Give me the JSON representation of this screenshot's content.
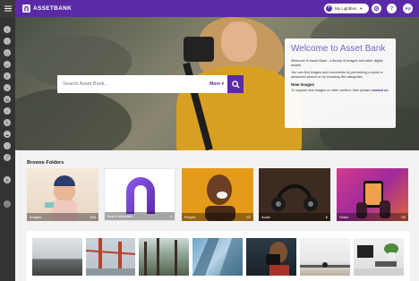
{
  "app": {
    "name": "ASSETBANK"
  },
  "header": {
    "lightbox_label": "My Lightbox",
    "user_initials": "AU"
  },
  "search": {
    "placeholder": "Search Asset Bank...",
    "more_label": "More"
  },
  "welcome": {
    "title": "Welcome to Asset Bank",
    "intro": "Welcome to Asset Bank - a library of images and other digital assets.",
    "instructions": "You can find images and documents by performing a quick or advanced search or by browsing the categories.",
    "new_images_heading": "New Images",
    "new_images_text": "To request new images or other content, then please",
    "contact_link": "contact us."
  },
  "browse": {
    "title": "Browse Folders",
    "folders": [
      {
        "name": "Images",
        "count": "906"
      },
      {
        "name": "Brand Materials",
        "count": "4"
      },
      {
        "name": "People",
        "count": "57"
      },
      {
        "name": "Audio",
        "count": "6"
      },
      {
        "name": "Video",
        "count": "69"
      }
    ]
  }
}
